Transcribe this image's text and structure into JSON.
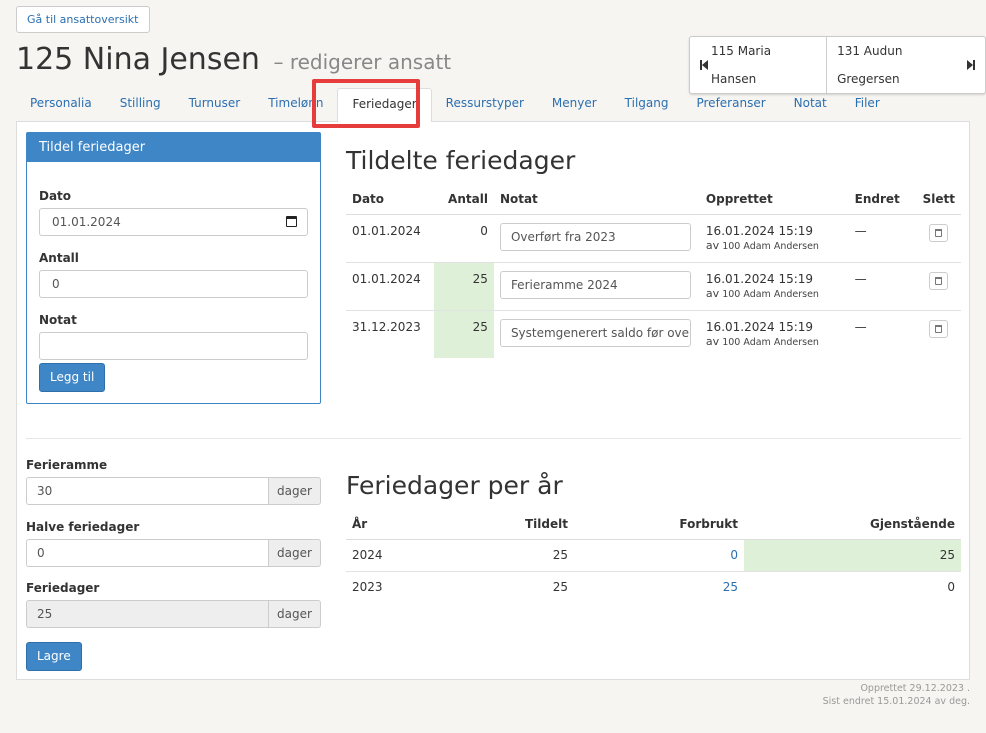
{
  "header": {
    "back_label": "Gå til ansattoversikt",
    "title": "125 Nina Jensen",
    "subtitle": "– redigerer ansatt",
    "prev_employee": "115 Maria Hansen",
    "next_employee": "131 Audun Gregersen"
  },
  "tabs": [
    {
      "label": "Personalia"
    },
    {
      "label": "Stilling"
    },
    {
      "label": "Turnuser"
    },
    {
      "label": "Timelønn"
    },
    {
      "label": "Feriedager",
      "active": true
    },
    {
      "label": "Ressurstyper"
    },
    {
      "label": "Menyer"
    },
    {
      "label": "Tilgang"
    },
    {
      "label": "Preferanser"
    },
    {
      "label": "Notat"
    },
    {
      "label": "Filer"
    }
  ],
  "assign": {
    "title": "Tildel feriedager",
    "date_label": "Dato",
    "date_value": "01.01.2024",
    "count_label": "Antall",
    "count_value": "0",
    "note_label": "Notat",
    "note_value": "",
    "add_label": "Legg til"
  },
  "settings": {
    "frame_label": "Ferieramme",
    "frame_value": "30",
    "half_label": "Halve feriedager",
    "half_value": "0",
    "days_label": "Feriedager",
    "days_value": "25",
    "unit": "dager",
    "save_label": "Lagre"
  },
  "assigned": {
    "title": "Tildelte feriedager",
    "columns": {
      "date": "Dato",
      "count": "Antall",
      "note": "Notat",
      "created": "Opprettet",
      "changed": "Endret",
      "delete": "Slett"
    },
    "rows": [
      {
        "date": "01.01.2024",
        "count": "0",
        "note": "Overført fra 2023",
        "created": "16.01.2024 15:19",
        "av": "av",
        "by": "100 Adam Andersen",
        "changed": "—"
      },
      {
        "date": "01.01.2024",
        "count": "25",
        "note": "Ferieramme 2024",
        "created": "16.01.2024 15:19",
        "av": "av",
        "by": "100 Adam Andersen",
        "changed": "—"
      },
      {
        "date": "31.12.2023",
        "count": "25",
        "note": "Systemgenerert saldo før overføring",
        "created": "16.01.2024 15:19",
        "av": "av",
        "by": "100 Adam Andersen",
        "changed": "—"
      }
    ]
  },
  "per_year": {
    "title": "Feriedager per år",
    "columns": {
      "year": "År",
      "given": "Tildelt",
      "used": "Forbrukt",
      "remaining": "Gjenstående"
    },
    "rows": [
      {
        "year": "2024",
        "given": "25",
        "used": "0",
        "remaining": "25"
      },
      {
        "year": "2023",
        "given": "25",
        "used": "25",
        "remaining": "0"
      }
    ]
  },
  "footer": {
    "created": "Opprettet 29.12.2023 .",
    "changed": "Sist endret 15.01.2024 av deg."
  },
  "colors": {
    "accent": "#3f86c7",
    "highlight": "#e63c3c",
    "success_bg": "#dff0d8"
  }
}
